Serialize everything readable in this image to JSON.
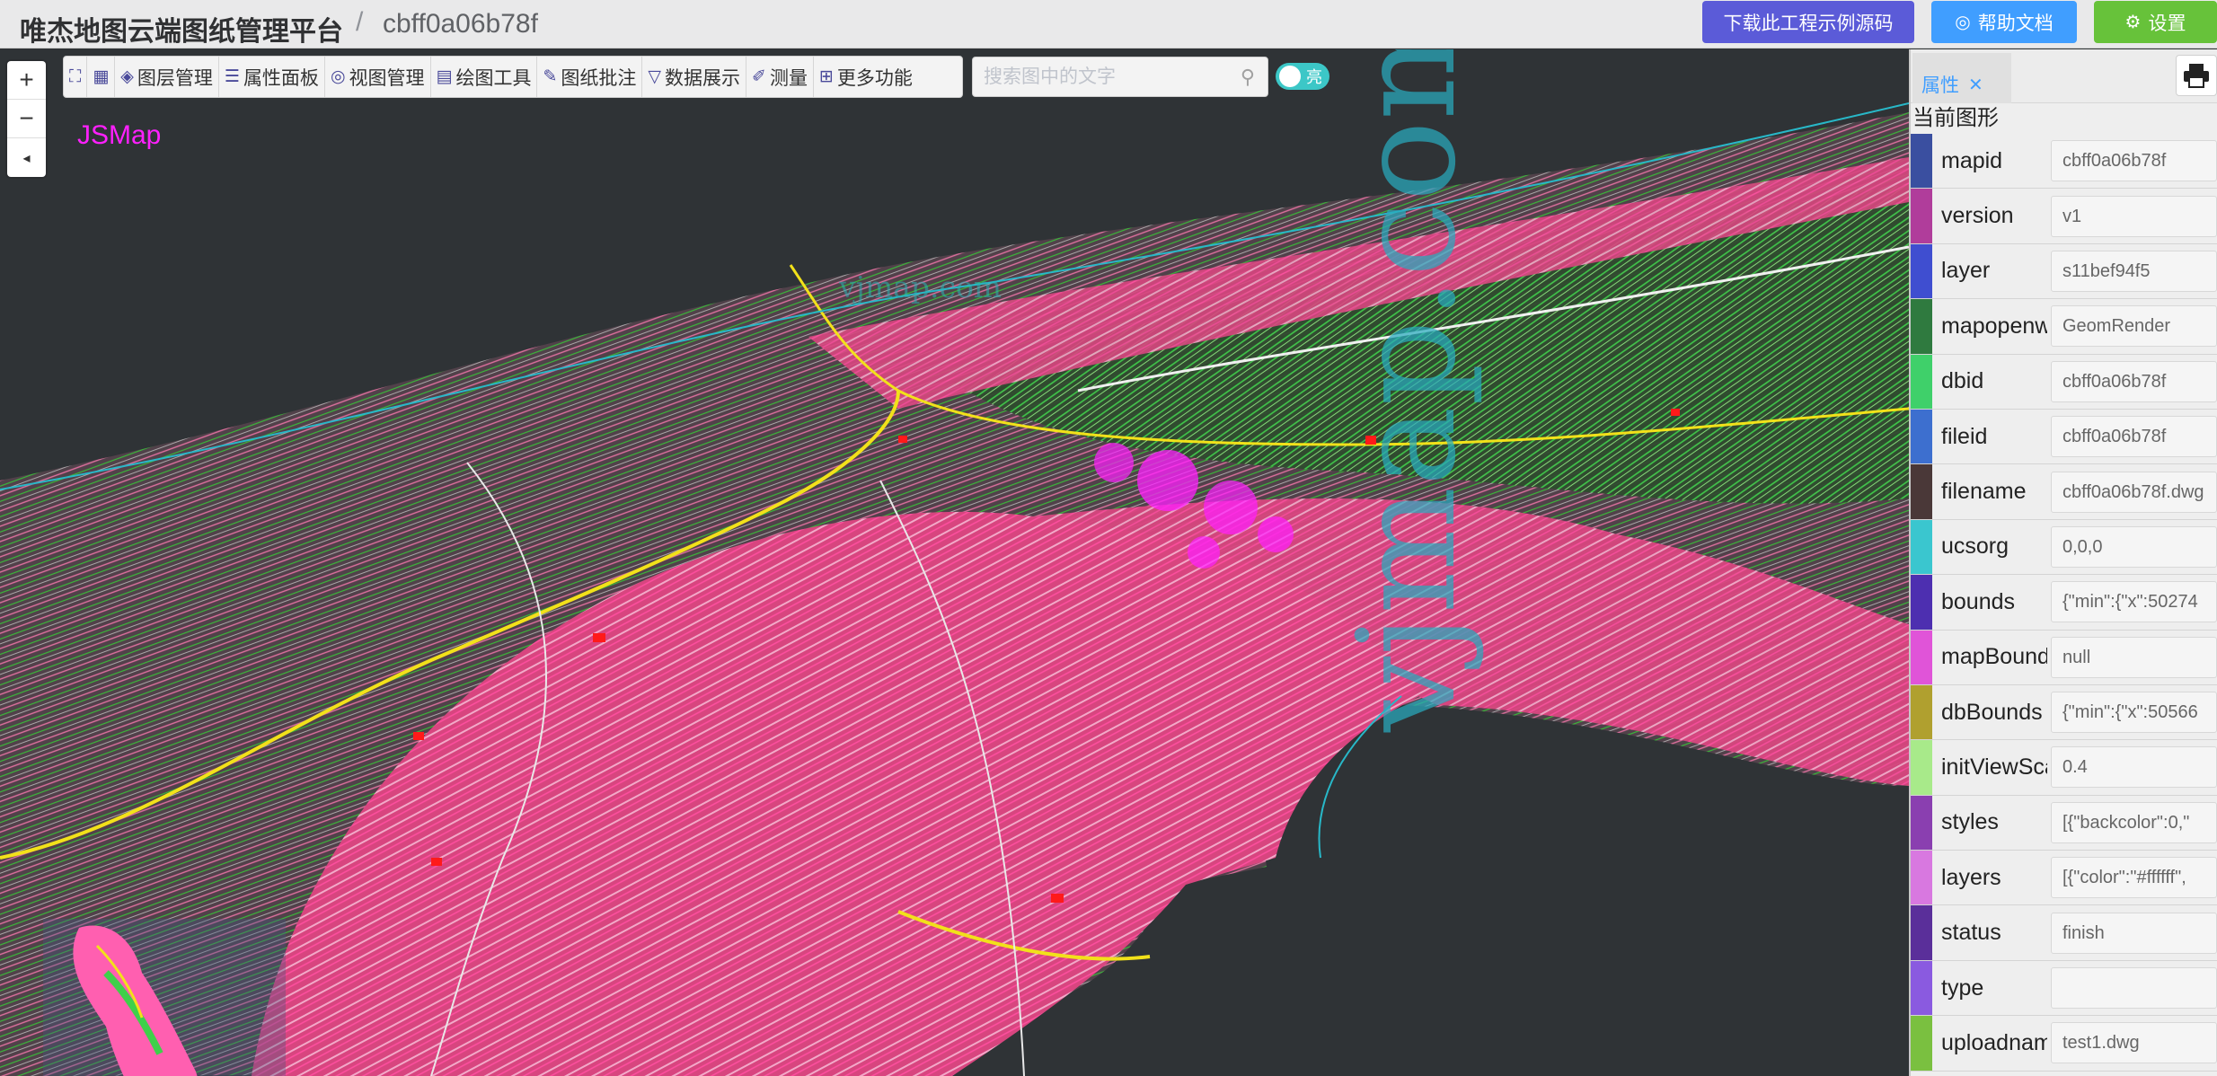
{
  "header": {
    "title": "唯杰地图云端图纸管理平台",
    "separator": "/",
    "map_id": "cbff0a06b78f",
    "download_label": "下载此工程示例源码",
    "help_label": "帮助文档",
    "settings_label": "设置"
  },
  "map": {
    "brand_label": "JSMap",
    "watermark_small": "vjmap.com",
    "watermark_big": "vjmap.com",
    "zoom_in": "+",
    "zoom_out": "−",
    "reset_north": "◂"
  },
  "toolbar": {
    "items": [
      {
        "icon": "fullscreen-icon",
        "label": ""
      },
      {
        "icon": "qrcode-icon",
        "label": ""
      },
      {
        "icon": "layers-icon",
        "label": "图层管理"
      },
      {
        "icon": "properties-icon",
        "label": "属性面板"
      },
      {
        "icon": "view-icon",
        "label": "视图管理"
      },
      {
        "icon": "draw-icon",
        "label": "绘图工具"
      },
      {
        "icon": "annotate-icon",
        "label": "图纸批注"
      },
      {
        "icon": "filter-icon",
        "label": "数据展示"
      },
      {
        "icon": "measure-icon",
        "label": "测量"
      },
      {
        "icon": "more-icon",
        "label": "更多功能"
      }
    ]
  },
  "search": {
    "placeholder": "搜索图中的文字",
    "value": ""
  },
  "theme_toggle": {
    "label": "亮"
  },
  "panel": {
    "tab_label": "属性",
    "subtitle": "当前图形",
    "rows": [
      {
        "key": "mapid",
        "value": "cbff0a06b78f",
        "color": "#3a4fa0"
      },
      {
        "key": "version",
        "value": "v1",
        "color": "#b03d9b"
      },
      {
        "key": "layer",
        "value": "s11bef94f5",
        "color": "#3f4ed0"
      },
      {
        "key": "mapopenway",
        "value": "GeomRender",
        "color": "#2f7a3f"
      },
      {
        "key": "dbid",
        "value": "cbff0a06b78f",
        "color": "#3fd06a"
      },
      {
        "key": "fileid",
        "value": "cbff0a06b78f",
        "color": "#3d6fcf"
      },
      {
        "key": "filename",
        "value": "cbff0a06b78f.dwg",
        "color": "#4a3838"
      },
      {
        "key": "ucsorg",
        "value": "0,0,0",
        "color": "#3ac6cf"
      },
      {
        "key": "bounds",
        "value": "{\"min\":{\"x\":50274",
        "color": "#4d2fb0"
      },
      {
        "key": "mapBounds",
        "value": "null",
        "color": "#e054d8"
      },
      {
        "key": "dbBounds",
        "value": "{\"min\":{\"x\":50566",
        "color": "#b0a02f"
      },
      {
        "key": "initViewScale",
        "value": "0.4",
        "color": "#a8ea8a"
      },
      {
        "key": "styles",
        "value": "[{\"backcolor\":0,\"",
        "color": "#8a3fb0"
      },
      {
        "key": "layers",
        "value": "[{\"color\":\"#ffffff\",",
        "color": "#d878e0"
      },
      {
        "key": "status",
        "value": "finish",
        "color": "#5a2f9a"
      },
      {
        "key": "type",
        "value": "",
        "color": "#8a5ae0"
      },
      {
        "key": "uploadname",
        "value": "test1.dwg",
        "color": "#7ac040"
      }
    ]
  },
  "colors": {
    "contour_pink": "#e8559a",
    "road_yellow": "#f2e11a",
    "green_contour": "#33c23a",
    "map_bg": "#2f3336"
  }
}
